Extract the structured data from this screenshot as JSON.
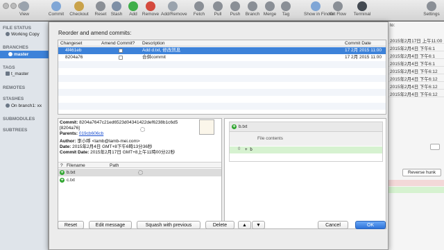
{
  "toolbar": {
    "items": [
      {
        "label": "View",
        "icon": "view-icon",
        "color": "#9aa3ad"
      },
      {
        "label": "Commit",
        "icon": "commit-icon",
        "color": "#7fa6d6"
      },
      {
        "label": "Checkout",
        "icon": "checkout-icon",
        "color": "#c9a24a"
      },
      {
        "label": "Reset",
        "icon": "reset-icon",
        "color": "#8a8f96"
      },
      {
        "label": "Stash",
        "icon": "stash-icon",
        "color": "#7d8fa6"
      },
      {
        "label": "Add",
        "icon": "add-icon",
        "color": "#3fae4a"
      },
      {
        "label": "Remove",
        "icon": "remove-icon",
        "color": "#d44a3e"
      },
      {
        "label": "Add/Remove",
        "icon": "add-remove-icon",
        "color": "#9aa3ad"
      },
      {
        "label": "Fetch",
        "icon": "fetch-icon",
        "color": "#8a8f96"
      },
      {
        "label": "Pull",
        "icon": "pull-icon",
        "color": "#8a8f96"
      },
      {
        "label": "Push",
        "icon": "push-icon",
        "color": "#8a8f96"
      },
      {
        "label": "Branch",
        "icon": "branch-icon",
        "color": "#8a8f96"
      },
      {
        "label": "Merge",
        "icon": "merge-icon",
        "color": "#8a8f96"
      },
      {
        "label": "Tag",
        "icon": "tag-icon",
        "color": "#8a8f96"
      },
      {
        "label": "Show in Finder",
        "icon": "finder-icon",
        "color": "#7fa6d6"
      },
      {
        "label": "Git Flow",
        "icon": "git-flow-icon",
        "color": "#8a8f96"
      },
      {
        "label": "Terminal",
        "icon": "terminal-icon",
        "color": "#444a52"
      },
      {
        "label": "Settings",
        "icon": "settings-icon",
        "color": "#8a8f96"
      }
    ]
  },
  "sidebar": {
    "file_status": "FILE STATUS",
    "working_copy": "Working Copy",
    "branches": "BRANCHES",
    "master": "master",
    "tags": "TAGS",
    "tag_item": "t_master",
    "remotes": "REMOTES",
    "stashes": "STASHES",
    "stash_item": "On branch1: xx",
    "submodules": "SUBMODULES",
    "subtrees": "SUBTREES"
  },
  "background": {
    "to_label": "to:",
    "dates": [
      "2015年2月17日 上午11:00",
      "2015年2月4日 下午6:1",
      "2015年2月4日 下午6:1",
      "2015年2月4日 下午6:1",
      "2015年2月4日 下午6:12",
      "2015年2月4日 下午6:12",
      "2015年2月4日 下午6:12",
      "2015年2月4日 下午6:12"
    ],
    "reverse_hunk": "Reverse hunk"
  },
  "dialog": {
    "title": "Reorder and amend commits:",
    "columns": [
      "Changeset",
      "Amend Commit?",
      "Description",
      "Commit Date"
    ],
    "rows": [
      {
        "changeset": "4f461eb",
        "description": "Add d.txt, 修改訊息",
        "date": "17 2月 2015 11:00"
      },
      {
        "changeset": "8204a76",
        "description": "合併commit",
        "date": "17 2月 2015 11:00"
      }
    ],
    "details": {
      "commit_label": "Commit:",
      "commit_hash": "8204a7647c21ed6523d04341422def6238b1c6d5",
      "commit_short": "[8204a76]",
      "parents_label": "Parents:",
      "parents_value": "019cb606cb",
      "author_label": "Author:",
      "author_value": "李小呼 <lamb@lamb-mei.com>",
      "date_label": "Date:",
      "date_value": "2015年2月4日 GMT+8下午6時13分36秒",
      "commit_date_label": "Commit Date:",
      "commit_date_value": "2015年2月17日 GMT+8上午11時00分22秒"
    },
    "files": {
      "columns": [
        "?",
        "Filename",
        "Path"
      ],
      "items": [
        "b.txt",
        "c.txt"
      ]
    },
    "diff": {
      "filename": "b.txt",
      "hunk": "File contents",
      "line_no": "0",
      "line_text": "+ b"
    },
    "buttons": {
      "reset": "Reset",
      "edit_message": "Edit message",
      "squash": "Squash with previous",
      "delete": "Delete",
      "up": "▲",
      "down": "▼",
      "cancel": "Cancel",
      "ok": "OK"
    },
    "colors": {
      "accent": "#3d82d9",
      "add_green": "#2fa52f"
    }
  }
}
